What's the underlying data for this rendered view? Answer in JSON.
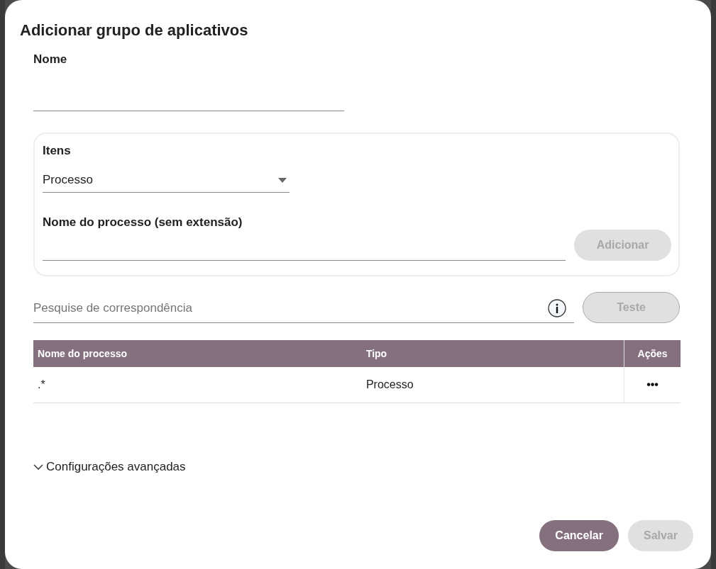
{
  "dialog": {
    "title": "Adicionar grupo de aplicativos"
  },
  "name_field": {
    "label": "Nome"
  },
  "items_panel": {
    "label": "Itens",
    "dropdown": {
      "value": "Processo"
    },
    "process_label": "Nome do processo (sem extensão)",
    "add_button": {
      "label": "Adicionar",
      "disabled": true
    }
  },
  "search": {
    "placeholder": "Pesquise de correspondência",
    "test_button": {
      "label": "Teste",
      "disabled": true
    }
  },
  "table": {
    "columns": [
      "Nome do processo",
      "Tipo",
      "Ações"
    ],
    "rows": [
      {
        "name": ".*",
        "type": "Processo",
        "actions": "•••"
      }
    ]
  },
  "advanced": {
    "label": "Configurações avançadas",
    "expanded": false
  },
  "buttons": [
    {
      "label": "Cancelar",
      "disabled": false
    },
    {
      "label": "Salvar",
      "disabled": true
    }
  ]
}
